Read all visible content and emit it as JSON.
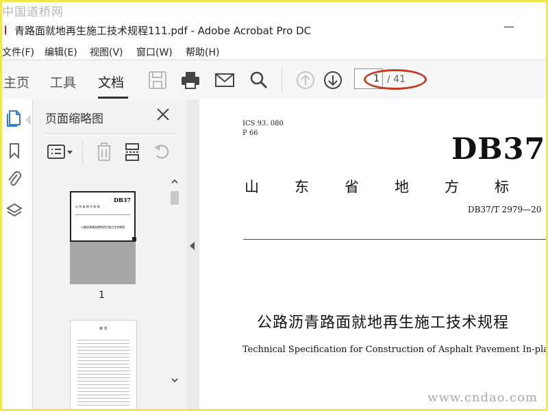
{
  "watermark": {
    "top": "中国道桥网",
    "bottom": "www.cndao.com"
  },
  "window": {
    "title": "青路面就地再生施工技术规程111.pdf - Adobe Acrobat Pro DC",
    "minimize": "—"
  },
  "menu": [
    "文件(F)",
    "编辑(E)",
    "视图(V)",
    "窗口(W)",
    "帮助(H)"
  ],
  "nav": {
    "home": "主页",
    "tools": "工具",
    "document": "文档"
  },
  "toolbar": {
    "icons": [
      "save-icon",
      "print-icon",
      "email-icon",
      "search-icon",
      "page-up-icon",
      "page-down-icon"
    ],
    "page_current": "1",
    "page_total": "/ 41"
  },
  "panel": {
    "title": "页面缩略图",
    "thumbnail_page_label": "1"
  },
  "thumb1": {
    "code": "DB37",
    "std": "山 东 省 地 方 标 准",
    "cn": "公路沥青路面就地再生施工技术规程"
  },
  "thumb2": {
    "title": "目 次"
  },
  "document": {
    "ics": "ICS 93. 080",
    "p": "P 66",
    "code": "DB37",
    "standard_type": "山东省地方标",
    "standard_number": "DB37/T 2979—20",
    "title_cn": "公路沥青路面就地再生施工技术规程",
    "title_en": "Technical Specification for Construction of Asphalt Pavement In-place Recycling"
  },
  "colors": {
    "annotation": "#c23b1d",
    "frame": "#f0e84a",
    "pdf_red": "#c8261d"
  }
}
